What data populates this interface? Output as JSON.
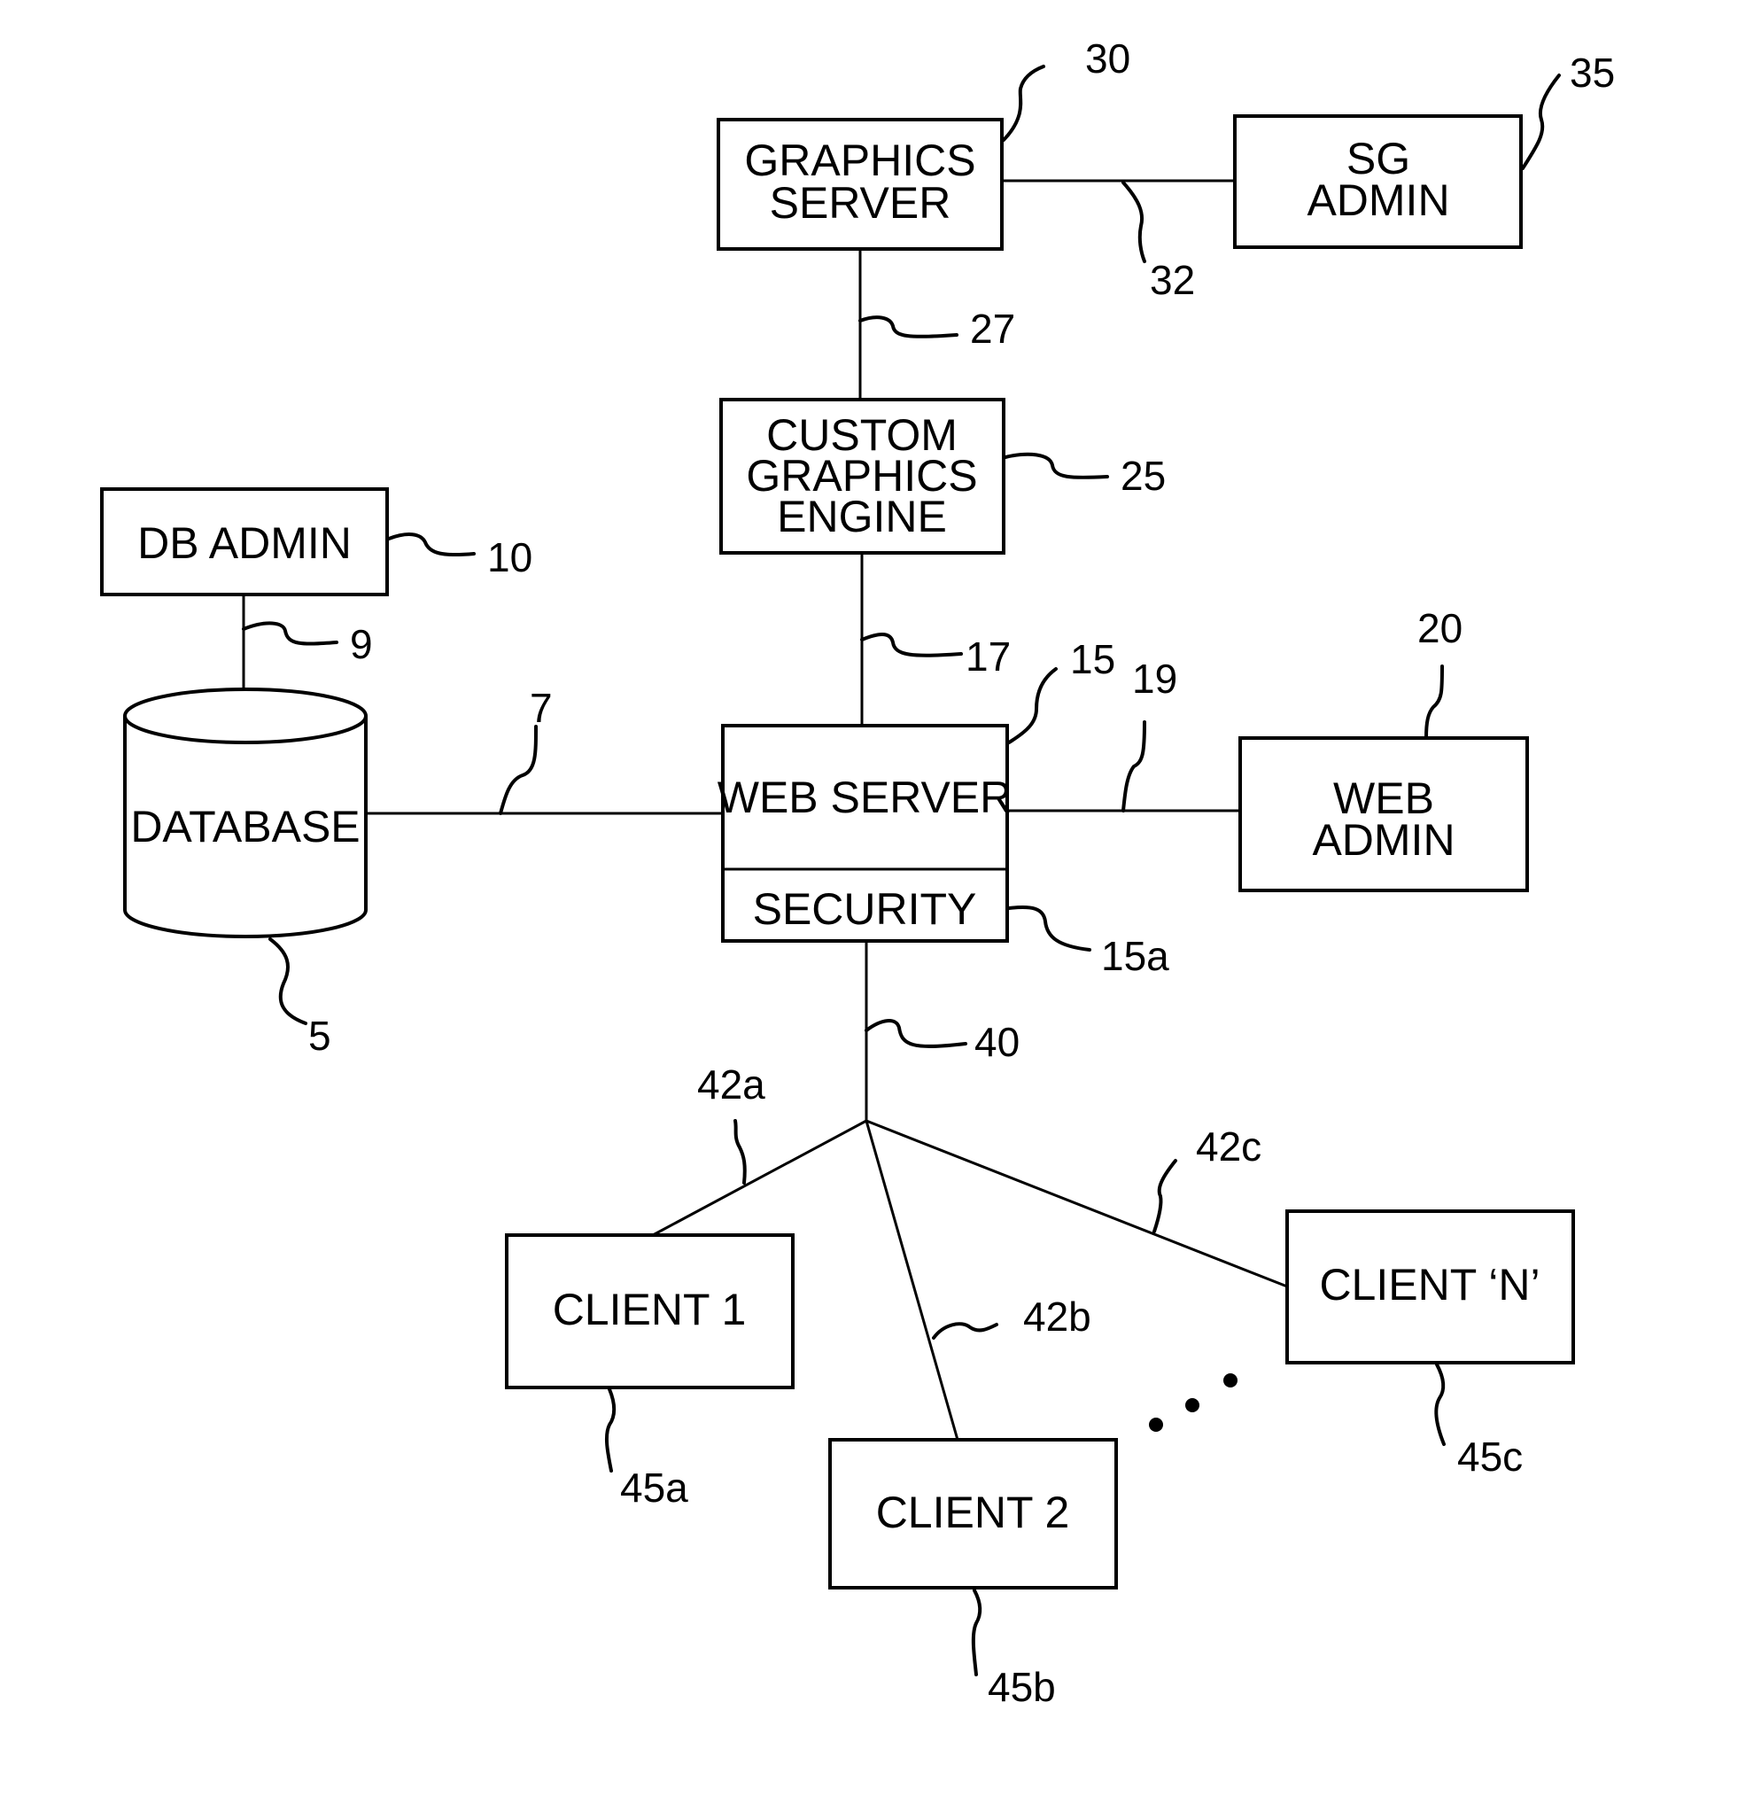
{
  "diagram": {
    "type": "system-architecture-block-diagram",
    "nodes": {
      "graphics_server": {
        "lines": [
          "GRAPHICS",
          "SERVER"
        ],
        "ref": "30"
      },
      "sg_admin": {
        "lines": [
          "SG",
          "ADMIN"
        ],
        "ref": "35"
      },
      "custom_graphics_engine": {
        "lines": [
          "CUSTOM",
          "GRAPHICS",
          "ENGINE"
        ],
        "ref": "25"
      },
      "db_admin": {
        "lines": [
          "DB ADMIN"
        ],
        "ref": "10"
      },
      "database": {
        "lines": [
          "DATABASE"
        ],
        "ref": "5"
      },
      "web_server": {
        "lines": [
          "WEB SERVER"
        ],
        "ref": "15"
      },
      "security": {
        "lines": [
          "SECURITY"
        ],
        "ref": "15a"
      },
      "web_admin": {
        "lines": [
          "WEB",
          "ADMIN"
        ],
        "ref": "20"
      },
      "client_1": {
        "lines": [
          "CLIENT 1"
        ],
        "ref": "45a"
      },
      "client_2": {
        "lines": [
          "CLIENT 2"
        ],
        "ref": "45b"
      },
      "client_n": {
        "lines": [
          "CLIENT ‘N’"
        ],
        "ref": "45c"
      }
    },
    "connections": [
      {
        "from": "graphics_server",
        "to": "sg_admin",
        "ref": "32"
      },
      {
        "from": "graphics_server",
        "to": "custom_graphics_engine",
        "ref": "27"
      },
      {
        "from": "custom_graphics_engine",
        "to": "web_server",
        "ref": "17"
      },
      {
        "from": "db_admin",
        "to": "database",
        "ref": "9"
      },
      {
        "from": "database",
        "to": "web_server",
        "ref": "7"
      },
      {
        "from": "web_server",
        "to": "web_admin",
        "ref": "19"
      },
      {
        "from": "web_server",
        "to": "client_hub",
        "ref": "40"
      },
      {
        "from": "client_hub",
        "to": "client_1",
        "ref": "42a"
      },
      {
        "from": "client_hub",
        "to": "client_2",
        "ref": "42b"
      },
      {
        "from": "client_hub",
        "to": "client_n",
        "ref": "42c"
      }
    ],
    "ellipsis": "• • •"
  }
}
